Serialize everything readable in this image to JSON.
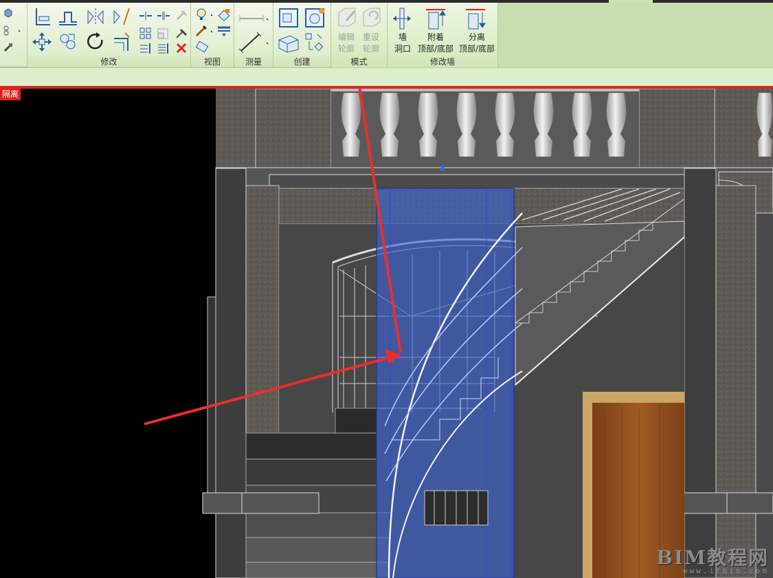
{
  "ribbon": {
    "panels": {
      "modify": "修改",
      "view": "视图",
      "measure": "测量",
      "create": "创建",
      "mode": "模式",
      "modify_wall": "修改墙"
    },
    "buttons": {
      "edit_profile": [
        "编辑",
        "轮廓"
      ],
      "reset_profile": [
        "重设",
        "轮廓"
      ],
      "wall_opening": [
        "墙",
        "洞口"
      ],
      "attach_top_base": [
        "附着",
        "顶部/底部"
      ],
      "detach_top_base": [
        "分离",
        "顶部/底部"
      ]
    }
  },
  "viewport": {
    "temporary_isolate_tag": "隔离"
  },
  "watermark": {
    "brand": "BIM教程网",
    "url": "www.ifbim.com"
  },
  "colors": {
    "ribbon_bg": "#e6f1d6",
    "isolate_red": "#e0231f",
    "selection_blue": "#3a62d6",
    "arrow_red": "#e8302a"
  }
}
